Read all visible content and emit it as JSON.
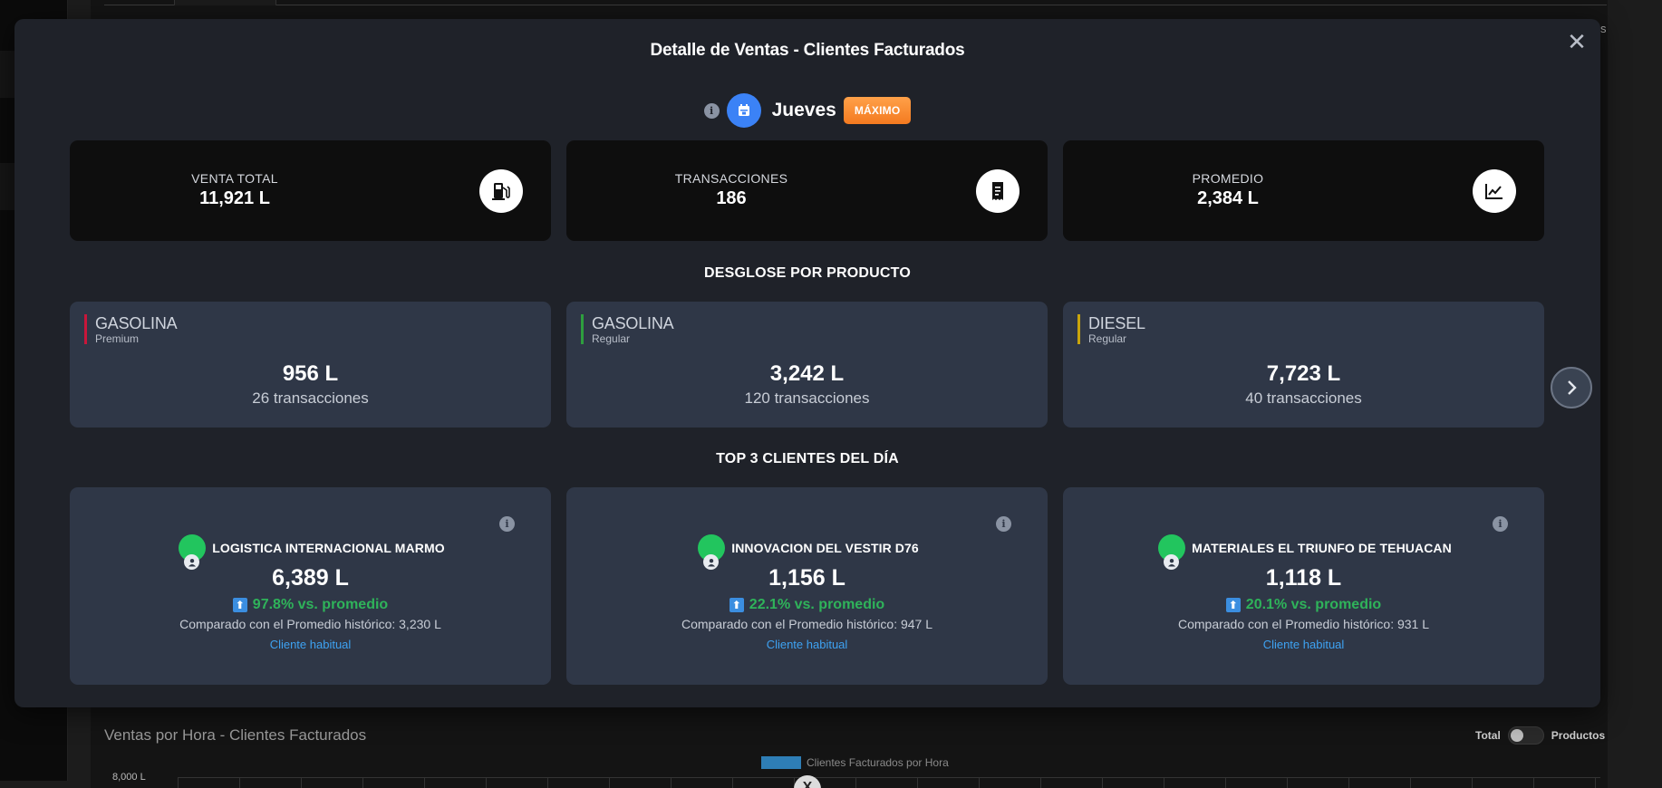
{
  "background": {
    "chart_title": "Ventas por Hora - Clientes Facturados",
    "toggle_left": "Total",
    "toggle_right": "Productos",
    "legend_label": "Clientes Facturados por Hora",
    "y_tick_top": "8,000 L",
    "edge_char": "s",
    "close_x": "X"
  },
  "modal": {
    "title": "Detalle de Ventas - Clientes Facturados",
    "close_label": "✕",
    "info_glyph": "i",
    "day": "Jueves",
    "day_badge": "MÁXIMO",
    "stats": [
      {
        "label": "VENTA TOTAL",
        "value": "11,921 L",
        "icon": "fuel-pump-icon"
      },
      {
        "label": "TRANSACCIONES",
        "value": "186",
        "icon": "receipt-icon"
      },
      {
        "label": "PROMEDIO",
        "value": "2,384 L",
        "icon": "line-chart-icon"
      }
    ],
    "products_title": "DESGLOSE POR PRODUCTO",
    "products": [
      {
        "name": "GASOLINA",
        "sub": "Premium",
        "value": "956 L",
        "count": "26 transacciones",
        "color": "#c8163a"
      },
      {
        "name": "GASOLINA",
        "sub": "Regular",
        "value": "3,242 L",
        "count": "120 transacciones",
        "color": "#2e9e3e"
      },
      {
        "name": "DIESEL",
        "sub": "Regular",
        "value": "7,723 L",
        "count": "40 transacciones",
        "color": "#c9a40c"
      }
    ],
    "clients_title": "TOP 3 CLIENTES DEL DÍA",
    "clients": [
      {
        "name": "LOGISTICA INTERNACIONAL MARMO",
        "value": "6,389 L",
        "pct": "97.8% vs. promedio",
        "compare": "Comparado con el Promedio histórico: 3,230 L",
        "tag": "Cliente habitual"
      },
      {
        "name": "INNOVACION DEL VESTIR D76",
        "value": "1,156 L",
        "pct": "22.1% vs. promedio",
        "compare": "Comparado con el Promedio histórico: 947 L",
        "tag": "Cliente habitual"
      },
      {
        "name": "MATERIALES EL TRIUNFO DE TEHUACAN",
        "value": "1,118 L",
        "pct": "20.1% vs. promedio",
        "compare": "Comparado con el Promedio histórico: 931 L",
        "tag": "Cliente habitual"
      }
    ],
    "colors": {
      "accent": "#3b82f6",
      "badge": "#f47a20",
      "positive": "#2fb35a",
      "link": "#3ea2f2",
      "card": "#2f3747"
    }
  }
}
